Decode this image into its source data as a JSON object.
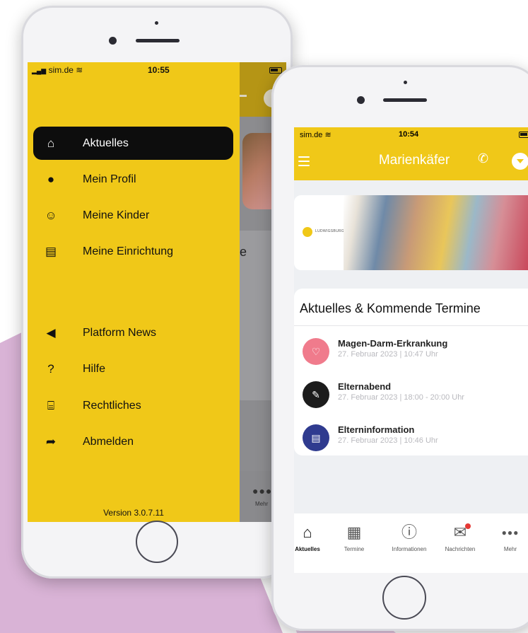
{
  "left_phone": {
    "status": {
      "carrier": "sim.de",
      "time": "10:55"
    },
    "menu": [
      {
        "label": "Aktuelles",
        "icon": "home-icon",
        "active": true
      },
      {
        "label": "Mein Profil",
        "icon": "person-icon",
        "active": false
      },
      {
        "label": "Meine Kinder",
        "icon": "child-face-icon",
        "active": false
      },
      {
        "label": "Meine Einrichtung",
        "icon": "document-icon",
        "active": false
      },
      {
        "label": "Platform News",
        "icon": "megaphone-icon",
        "active": false
      },
      {
        "label": "Hilfe",
        "icon": "question-icon",
        "active": false
      },
      {
        "label": "Rechtliches",
        "icon": "bank-icon",
        "active": false
      },
      {
        "label": "Abmelden",
        "icon": "logout-icon",
        "active": false
      }
    ],
    "version": "Version 3.0.7.11",
    "behind": {
      "partial_letter": "e",
      "more_label": "Mehr"
    }
  },
  "right_phone": {
    "status": {
      "carrier": "sim.de",
      "time": "10:54"
    },
    "header": {
      "title": "Marienkäfer"
    },
    "banner": {
      "logo_text": "LUDWIGSBURG"
    },
    "card": {
      "title": "Aktuelles & Kommende Termine",
      "events": [
        {
          "title": "Magen-Darm-Erkrankung",
          "date": "27. Februar 2023 | 10:47 Uhr",
          "icon": "heart-icon",
          "color": "#f07b8c"
        },
        {
          "title": "Elternabend",
          "date": "27. Februar 2023 | 18:00 - 20:00 Uhr",
          "icon": "chalkboard-icon",
          "color": "#1c1c1c"
        },
        {
          "title": "Elterninformation",
          "date": "27. Februar 2023 | 10:46 Uhr",
          "icon": "document-icon",
          "color": "#2f3b8f"
        }
      ]
    },
    "tabs": [
      {
        "label": "Aktuelles",
        "icon": "home-icon",
        "active": true
      },
      {
        "label": "Termine",
        "icon": "calendar-icon",
        "active": false
      },
      {
        "label": "Informationen",
        "icon": "info-icon",
        "active": false
      },
      {
        "label": "Nachrichten",
        "icon": "mail-icon",
        "active": false
      },
      {
        "label": "Mehr",
        "icon": "more-icon",
        "active": false
      }
    ]
  },
  "colors": {
    "brand_yellow": "#f0c818",
    "background_shape": "#d9b3d6"
  }
}
